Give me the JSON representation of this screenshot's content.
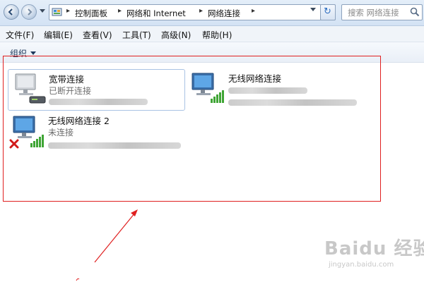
{
  "address_bar": {
    "breadcrumbs": [
      "控制面板",
      "网络和 Internet",
      "网络连接"
    ],
    "search_placeholder": "搜索 网络连接"
  },
  "menu": {
    "items": [
      "文件(F)",
      "编辑(E)",
      "查看(V)",
      "工具(T)",
      "高级(N)",
      "帮助(H)"
    ]
  },
  "command_bar": {
    "organize_label": "组织"
  },
  "connections": [
    {
      "name": "宽带连接",
      "status": "已断开连接",
      "icon": "broadband-computer-icon",
      "selected": true
    },
    {
      "name": "无线网络连接",
      "status": "",
      "icon": "wireless-computer-icon",
      "selected": false
    },
    {
      "name": "无线网络连接 2",
      "status": "未连接",
      "icon": "wireless-computer-disconnected-icon",
      "selected": false
    }
  ],
  "watermark": {
    "logo": "Baidu 经验",
    "url": "jingyan.baidu.com"
  },
  "colors": {
    "highlight_frame": "#e02020",
    "accent": "#2f6fc1",
    "signal_green": "#3fa535",
    "error_red": "#d11a1a"
  }
}
